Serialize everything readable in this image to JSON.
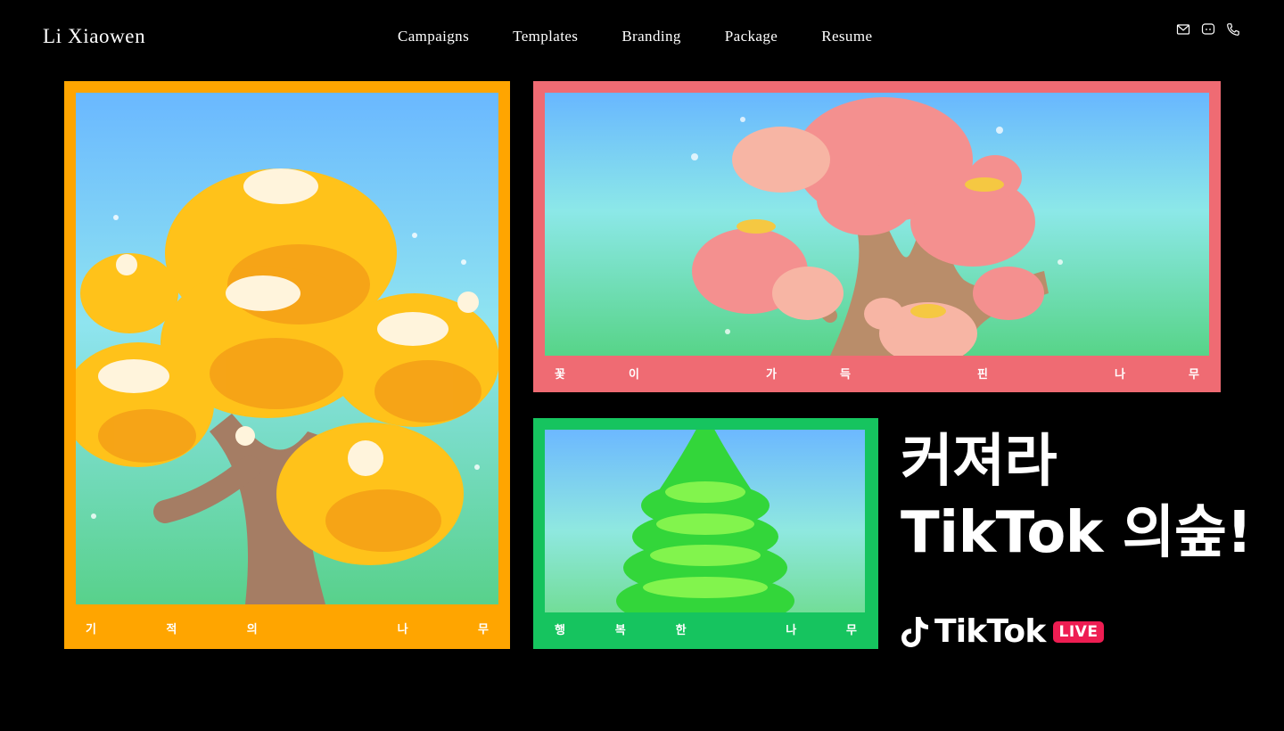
{
  "header": {
    "brand": "Li Xiaowen",
    "nav": [
      "Campaigns",
      "Templates",
      "Branding",
      "Package",
      "Resume"
    ],
    "contact_icons": [
      "mail-icon",
      "chat-icon",
      "phone-icon"
    ]
  },
  "cards": {
    "miracle_tree": {
      "caption": [
        "기",
        "적",
        "의",
        "나",
        "무"
      ],
      "color": "#ffa500"
    },
    "flower_tree": {
      "caption": [
        "꽃",
        "이",
        "가",
        "득",
        "핀",
        "나",
        "무"
      ],
      "color": "#ef6b73"
    },
    "happy_tree": {
      "caption": [
        "행",
        "복",
        "한",
        "나",
        "무"
      ],
      "color": "#16c45f"
    }
  },
  "promo": {
    "line1": "커져라",
    "line2": "TikTok 의숲!",
    "logo_word": "TikTok",
    "logo_badge": "LIVE"
  }
}
